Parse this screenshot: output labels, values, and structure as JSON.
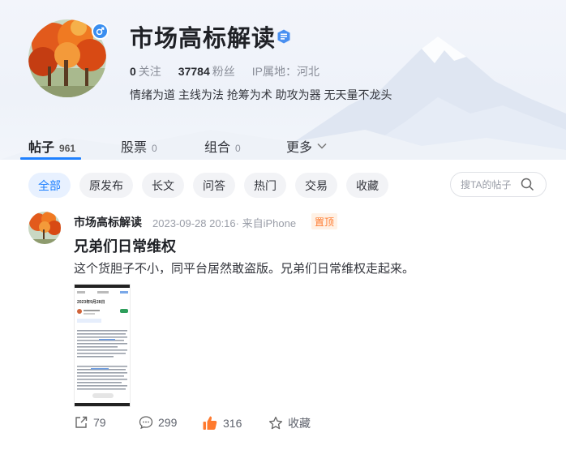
{
  "profile": {
    "name": "市场高标解读",
    "following_count": "0",
    "following_label": "关注",
    "followers_count": "37784",
    "followers_label": "粉丝",
    "ip_location": "IP属地：河北",
    "bio": "情绪为道 主线为法 抢筹为术 助攻为器 无天量不龙头",
    "gender_icon": "male-icon",
    "verify_icon": "verified-badge-icon"
  },
  "tabs": [
    {
      "label": "帖子",
      "count": "961",
      "active": true
    },
    {
      "label": "股票",
      "count": "0",
      "active": false
    },
    {
      "label": "组合",
      "count": "0",
      "active": false
    },
    {
      "label": "更多",
      "count": "",
      "active": false
    }
  ],
  "filters": [
    {
      "label": "全部",
      "active": true
    },
    {
      "label": "原发布",
      "active": false
    },
    {
      "label": "长文",
      "active": false
    },
    {
      "label": "问答",
      "active": false
    },
    {
      "label": "热门",
      "active": false
    },
    {
      "label": "交易",
      "active": false
    },
    {
      "label": "收藏",
      "active": false
    }
  ],
  "search": {
    "placeholder": "搜TA的帖子"
  },
  "post": {
    "author": "市场高标解读",
    "meta": "2023-09-28 20:16· 来自iPhone",
    "pin_label": "置顶",
    "title": "兄弟们日常维权",
    "body": "这个货胆子不小，同平台居然敢盗版。兄弟们日常维权走起来。",
    "image_caption": "2023年9月28日",
    "actions": {
      "repost": "79",
      "comments": "299",
      "likes": "316",
      "favorite": "收藏"
    }
  },
  "colors": {
    "accent": "#1e80ff",
    "pin": "#ff7a2e",
    "like": "#ff7a2e"
  }
}
